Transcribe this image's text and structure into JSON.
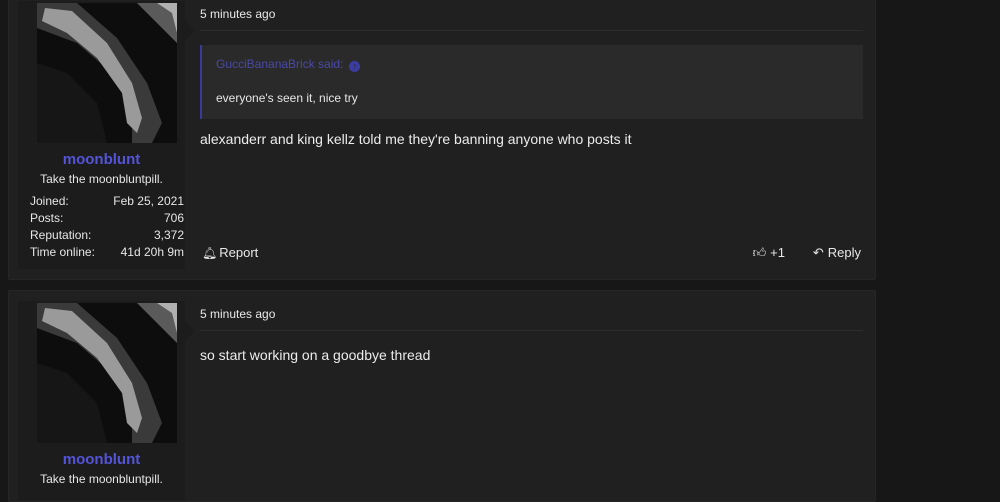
{
  "posts": [
    {
      "user": {
        "name": "moonblunt",
        "title": "Take the moonbluntpill.",
        "stats": [
          {
            "label": "Joined:",
            "value": "Feb 25, 2021"
          },
          {
            "label": "Posts:",
            "value": "706"
          },
          {
            "label": "Reputation:",
            "value": "3,372"
          },
          {
            "label": "Time online:",
            "value": "41d 20h 9m"
          }
        ]
      },
      "timestamp": "5 minutes ago",
      "quote": {
        "author": "GucciBananaBrick said:",
        "text": "everyone's seen it, nice try"
      },
      "message": "alexanderr and king kellz told me they're banning anyone who posts it",
      "actions": {
        "report": "Report",
        "likes": "+1",
        "reply": "Reply"
      }
    },
    {
      "user": {
        "name": "moonblunt",
        "title": "Take the moonbluntpill."
      },
      "timestamp": "5 minutes ago",
      "message": "so start working on a goodbye thread"
    }
  ],
  "icons": {
    "report": "bell-icon",
    "like": "thumbs-up-icon",
    "reply": "reply-arrow-icon",
    "quote_jump": "up-arrow-circle-icon"
  },
  "colors": {
    "username": "#5454d8",
    "quote_author": "#4a4aa6",
    "background": "#171717",
    "post": "#202020"
  }
}
